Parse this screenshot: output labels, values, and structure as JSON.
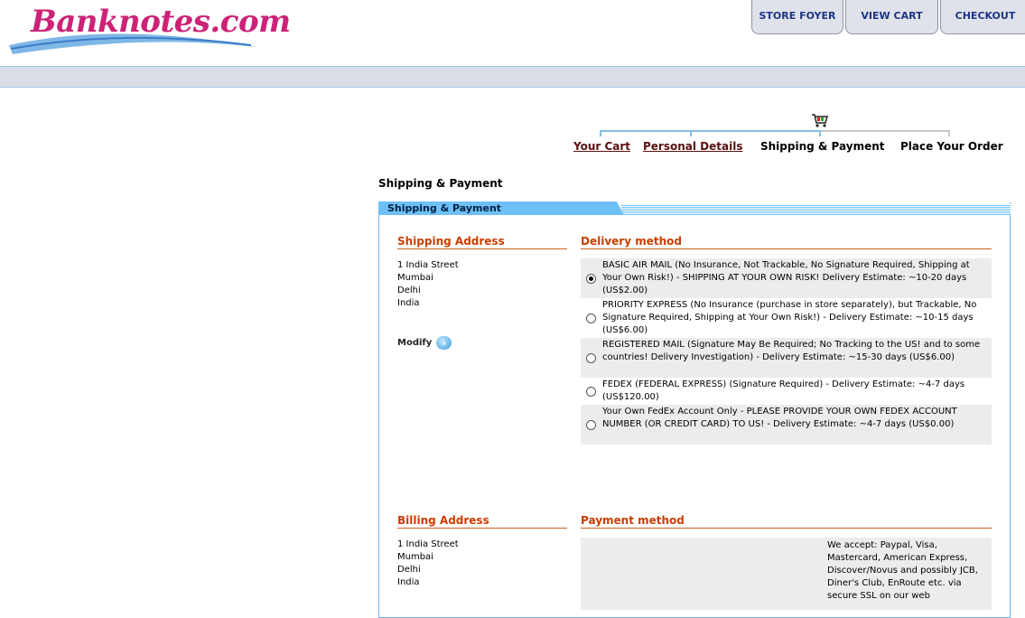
{
  "header": {
    "logo_text": "Banknotes.com",
    "buttons": {
      "store_foyer": "STORE FOYER",
      "view_cart": "VIEW CART",
      "checkout": "CHECKOUT"
    }
  },
  "steps": {
    "your_cart": "Your Cart",
    "personal_details": "Personal Details",
    "shipping_payment": "Shipping & Payment",
    "place_order": "Place Your Order"
  },
  "page_title": "Shipping & Payment",
  "panel_tab": "Shipping & Payment",
  "shipping": {
    "heading": "Shipping Address",
    "lines": [
      "1 India Street",
      "Mumbai",
      "Delhi",
      "India"
    ],
    "modify_label": "Modify"
  },
  "delivery": {
    "heading": "Delivery method",
    "options": [
      {
        "text": "BASIC AIR MAIL (No Insurance, Not Trackable, No Signature Required, Shipping at Your Own Risk!) - SHIPPING AT YOUR OWN RISK! Delivery Estimate: ~10-20 days (US$2.00)",
        "selected": true
      },
      {
        "text": "PRIORITY EXPRESS (No Insurance (purchase in store separately), but Trackable, No Signature Required, Shipping at Your Own Risk!) - Delivery Estimate: ~10-15 days (US$6.00)",
        "selected": false
      },
      {
        "text": "REGISTERED MAIL (Signature May Be Required; No Tracking to the US! and to some countries! Delivery Investigation) - Delivery Estimate: ~15-30 days (US$6.00)",
        "selected": false
      },
      {
        "text": "FEDEX (FEDERAL EXPRESS) (Signature Required) - Delivery Estimate: ~4-7 days (US$120.00)",
        "selected": false
      },
      {
        "text": "Your Own FedEx Account Only - PLEASE PROVIDE YOUR OWN FEDEX ACCOUNT NUMBER (OR CREDIT CARD) TO US! - Delivery Estimate: ~4-7 days (US$0.00)",
        "selected": false
      }
    ]
  },
  "billing": {
    "heading": "Billing Address",
    "lines": [
      "1 India Street",
      "Mumbai",
      "Delhi",
      "India"
    ]
  },
  "payment": {
    "heading": "Payment method",
    "accept_text": "We accept: Paypal, Visa, Mastercard, American Express, Discover/Novus and possibly JCB, Diner's Club, EnRoute etc. via secure SSL on our web"
  }
}
